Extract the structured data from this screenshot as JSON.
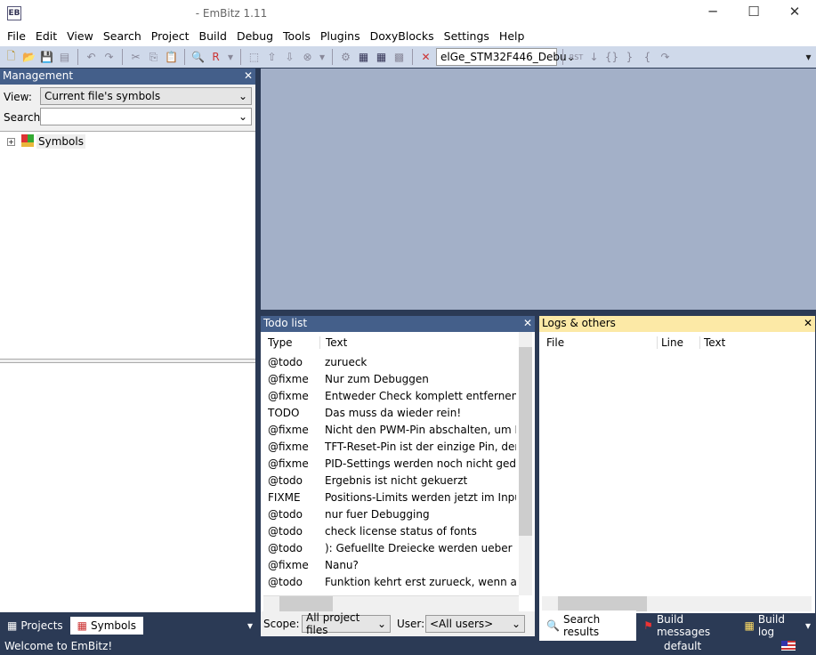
{
  "window": {
    "title": "- EmBitz 1.11",
    "minimize": "─",
    "maximize": "☐",
    "close": "✕"
  },
  "menu": [
    "File",
    "Edit",
    "View",
    "Search",
    "Project",
    "Build",
    "Debug",
    "Tools",
    "Plugins",
    "DoxyBlocks",
    "Settings",
    "Help"
  ],
  "toolbar": {
    "target": "elGe_STM32F446_Debu",
    "rst_label": "RST"
  },
  "management": {
    "title": "Management",
    "view_label": "View:",
    "view_value": "Current file's symbols",
    "search_label": "Search:",
    "search_value": "",
    "tree_root": "Symbols",
    "tabs": [
      "Projects",
      "Symbols"
    ],
    "active_tab": "Symbols"
  },
  "todo": {
    "title": "Todo list",
    "columns": [
      "Type",
      "Text"
    ],
    "rows": [
      [
        "@todo",
        "zurueck"
      ],
      [
        "@fixme",
        "Nur zum Debuggen"
      ],
      [
        "@fixme",
        "Entweder Check komplett entfernen oder"
      ],
      [
        "TODO",
        "Das muss da wieder rein!"
      ],
      [
        "@fixme",
        "Nicht den PWM-Pin abschalten, um Mors"
      ],
      [
        "@fixme",
        "TFT-Reset-Pin ist der einzige Pin, der nich"
      ],
      [
        "@fixme",
        "PID-Settings werden noch nicht gedumpt"
      ],
      [
        "@todo",
        "Ergebnis ist nicht gekuerzt"
      ],
      [
        "FIXME",
        "Positions-Limits werden jetzt im Input ein"
      ],
      [
        "@todo",
        "nur fuer Debugging"
      ],
      [
        "@todo",
        "check license status of fonts"
      ],
      [
        "@todo",
        "): Gefuellte Dreiecke werden ueber den Ra"
      ],
      [
        "@fixme",
        "Nanu?"
      ],
      [
        "@todo",
        "Funktion kehrt erst zurueck, wenn alles ue"
      ]
    ],
    "scope_label": "Scope:",
    "scope_value": "All project files",
    "user_label": "User:",
    "user_value": "<All users>"
  },
  "logs": {
    "title": "Logs & others",
    "columns": [
      "File",
      "Line",
      "Text"
    ],
    "tabs": [
      "Search results",
      "Build messages",
      "Build log"
    ],
    "active_tab": "Search results"
  },
  "status": {
    "message": "Welcome to EmBitz!",
    "profile": "default"
  },
  "colors": {
    "frame": "#2b3a55",
    "panel_header": "#445f8a",
    "editor_bg": "#a3b0c8",
    "toolbar": "#cfd9ea"
  }
}
